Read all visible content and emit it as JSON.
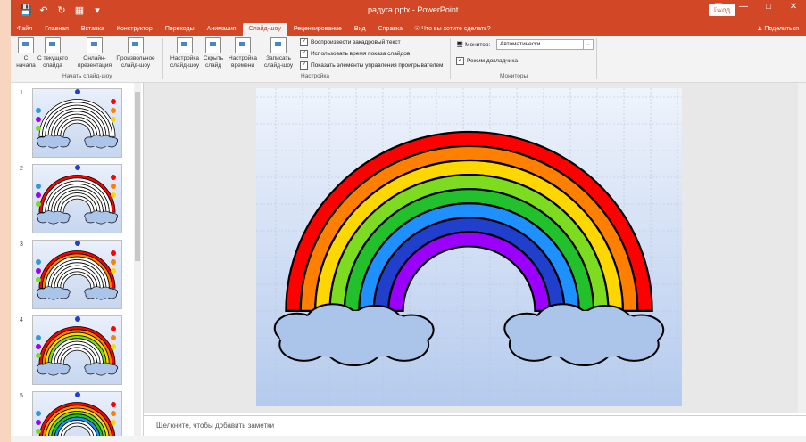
{
  "title": {
    "doc": "радуга.pptx - PowerPoint",
    "signin": "Вход"
  },
  "tabs": [
    "Файл",
    "Главная",
    "Вставка",
    "Конструктор",
    "Переходы",
    "Анимация",
    "Слайд-шоу",
    "Рецензирование",
    "Вид",
    "Справка"
  ],
  "active_tab": "Слайд-шоу",
  "tell_me": "Что вы хотите сделать?",
  "share": "Поделиться",
  "ribbon": {
    "btn_from_start": "С начала",
    "btn_from_current": "С текущего слайда",
    "btn_online": "Онлайн-презентация",
    "btn_custom": "Произвольное слайд-шоу",
    "group_start": "Начать слайд-шоу",
    "btn_setup": "Настройка слайд-шоу",
    "btn_hide": "Скрыть слайд",
    "btn_rehearse": "Настройка времени",
    "btn_record": "Записать слайд-шоу",
    "chk_narrations": "Воспроизвести закадровый текст",
    "chk_timings": "Использовать время показа слайдов",
    "chk_controls": "Показать элементы управления проигрывателем",
    "group_setup": "Настройка",
    "monitor_label": "Монитор:",
    "monitor_value": "Автоматически",
    "chk_presenter": "Режим докладчика",
    "group_monitors": "Мониторы"
  },
  "slides": [
    {
      "num": "1"
    },
    {
      "num": "2"
    },
    {
      "num": "3"
    },
    {
      "num": "4"
    },
    {
      "num": "5"
    }
  ],
  "colors": {
    "accent": "#d24726",
    "rainbow": [
      "#ff0000",
      "#ff7f00",
      "#ffd700",
      "#7ddc1f",
      "#22c02a",
      "#1e90ff",
      "#1f3fcc",
      "#9b00ff"
    ],
    "cloud": "#aac4ea"
  },
  "notes_placeholder": "Щелкните, чтобы добавить заметки"
}
